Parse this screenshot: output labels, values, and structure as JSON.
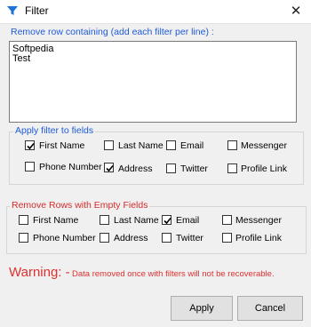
{
  "window": {
    "title": "Filter",
    "close_symbol": "✕"
  },
  "remove_contains": {
    "label": "Remove row containing (add each filter per line) :",
    "lines": [
      "Softpedia",
      "Test"
    ]
  },
  "apply_fields": {
    "label": "Apply filter to fields",
    "options": [
      {
        "label": "First Name",
        "checked": true
      },
      {
        "label": "Last Name",
        "checked": false
      },
      {
        "label": "Email",
        "checked": false
      },
      {
        "label": "Messenger",
        "checked": false
      },
      {
        "label": "Phone Number",
        "checked": false
      },
      {
        "label": "Address",
        "checked": true
      },
      {
        "label": "Twitter",
        "checked": false
      },
      {
        "label": "Profile Link",
        "checked": false
      }
    ]
  },
  "empty_fields": {
    "label": "Remove Rows with Empty Fields",
    "options": [
      {
        "label": "First Name",
        "checked": false
      },
      {
        "label": "Last Name",
        "checked": false
      },
      {
        "label": "Email",
        "checked": true
      },
      {
        "label": "Messenger",
        "checked": false
      },
      {
        "label": "Phone Number",
        "checked": false
      },
      {
        "label": "Address",
        "checked": false
      },
      {
        "label": "Twitter",
        "checked": false
      },
      {
        "label": "Profile Link",
        "checked": false
      }
    ]
  },
  "warning": {
    "title": "Warning: -",
    "text": "Data removed once with filters will not be recoverable."
  },
  "buttons": {
    "apply": "Apply",
    "cancel": "Cancel"
  },
  "colors": {
    "blue_label": "#1e5bd8",
    "red_label": "#d62b2b",
    "warning": "#e03030"
  }
}
